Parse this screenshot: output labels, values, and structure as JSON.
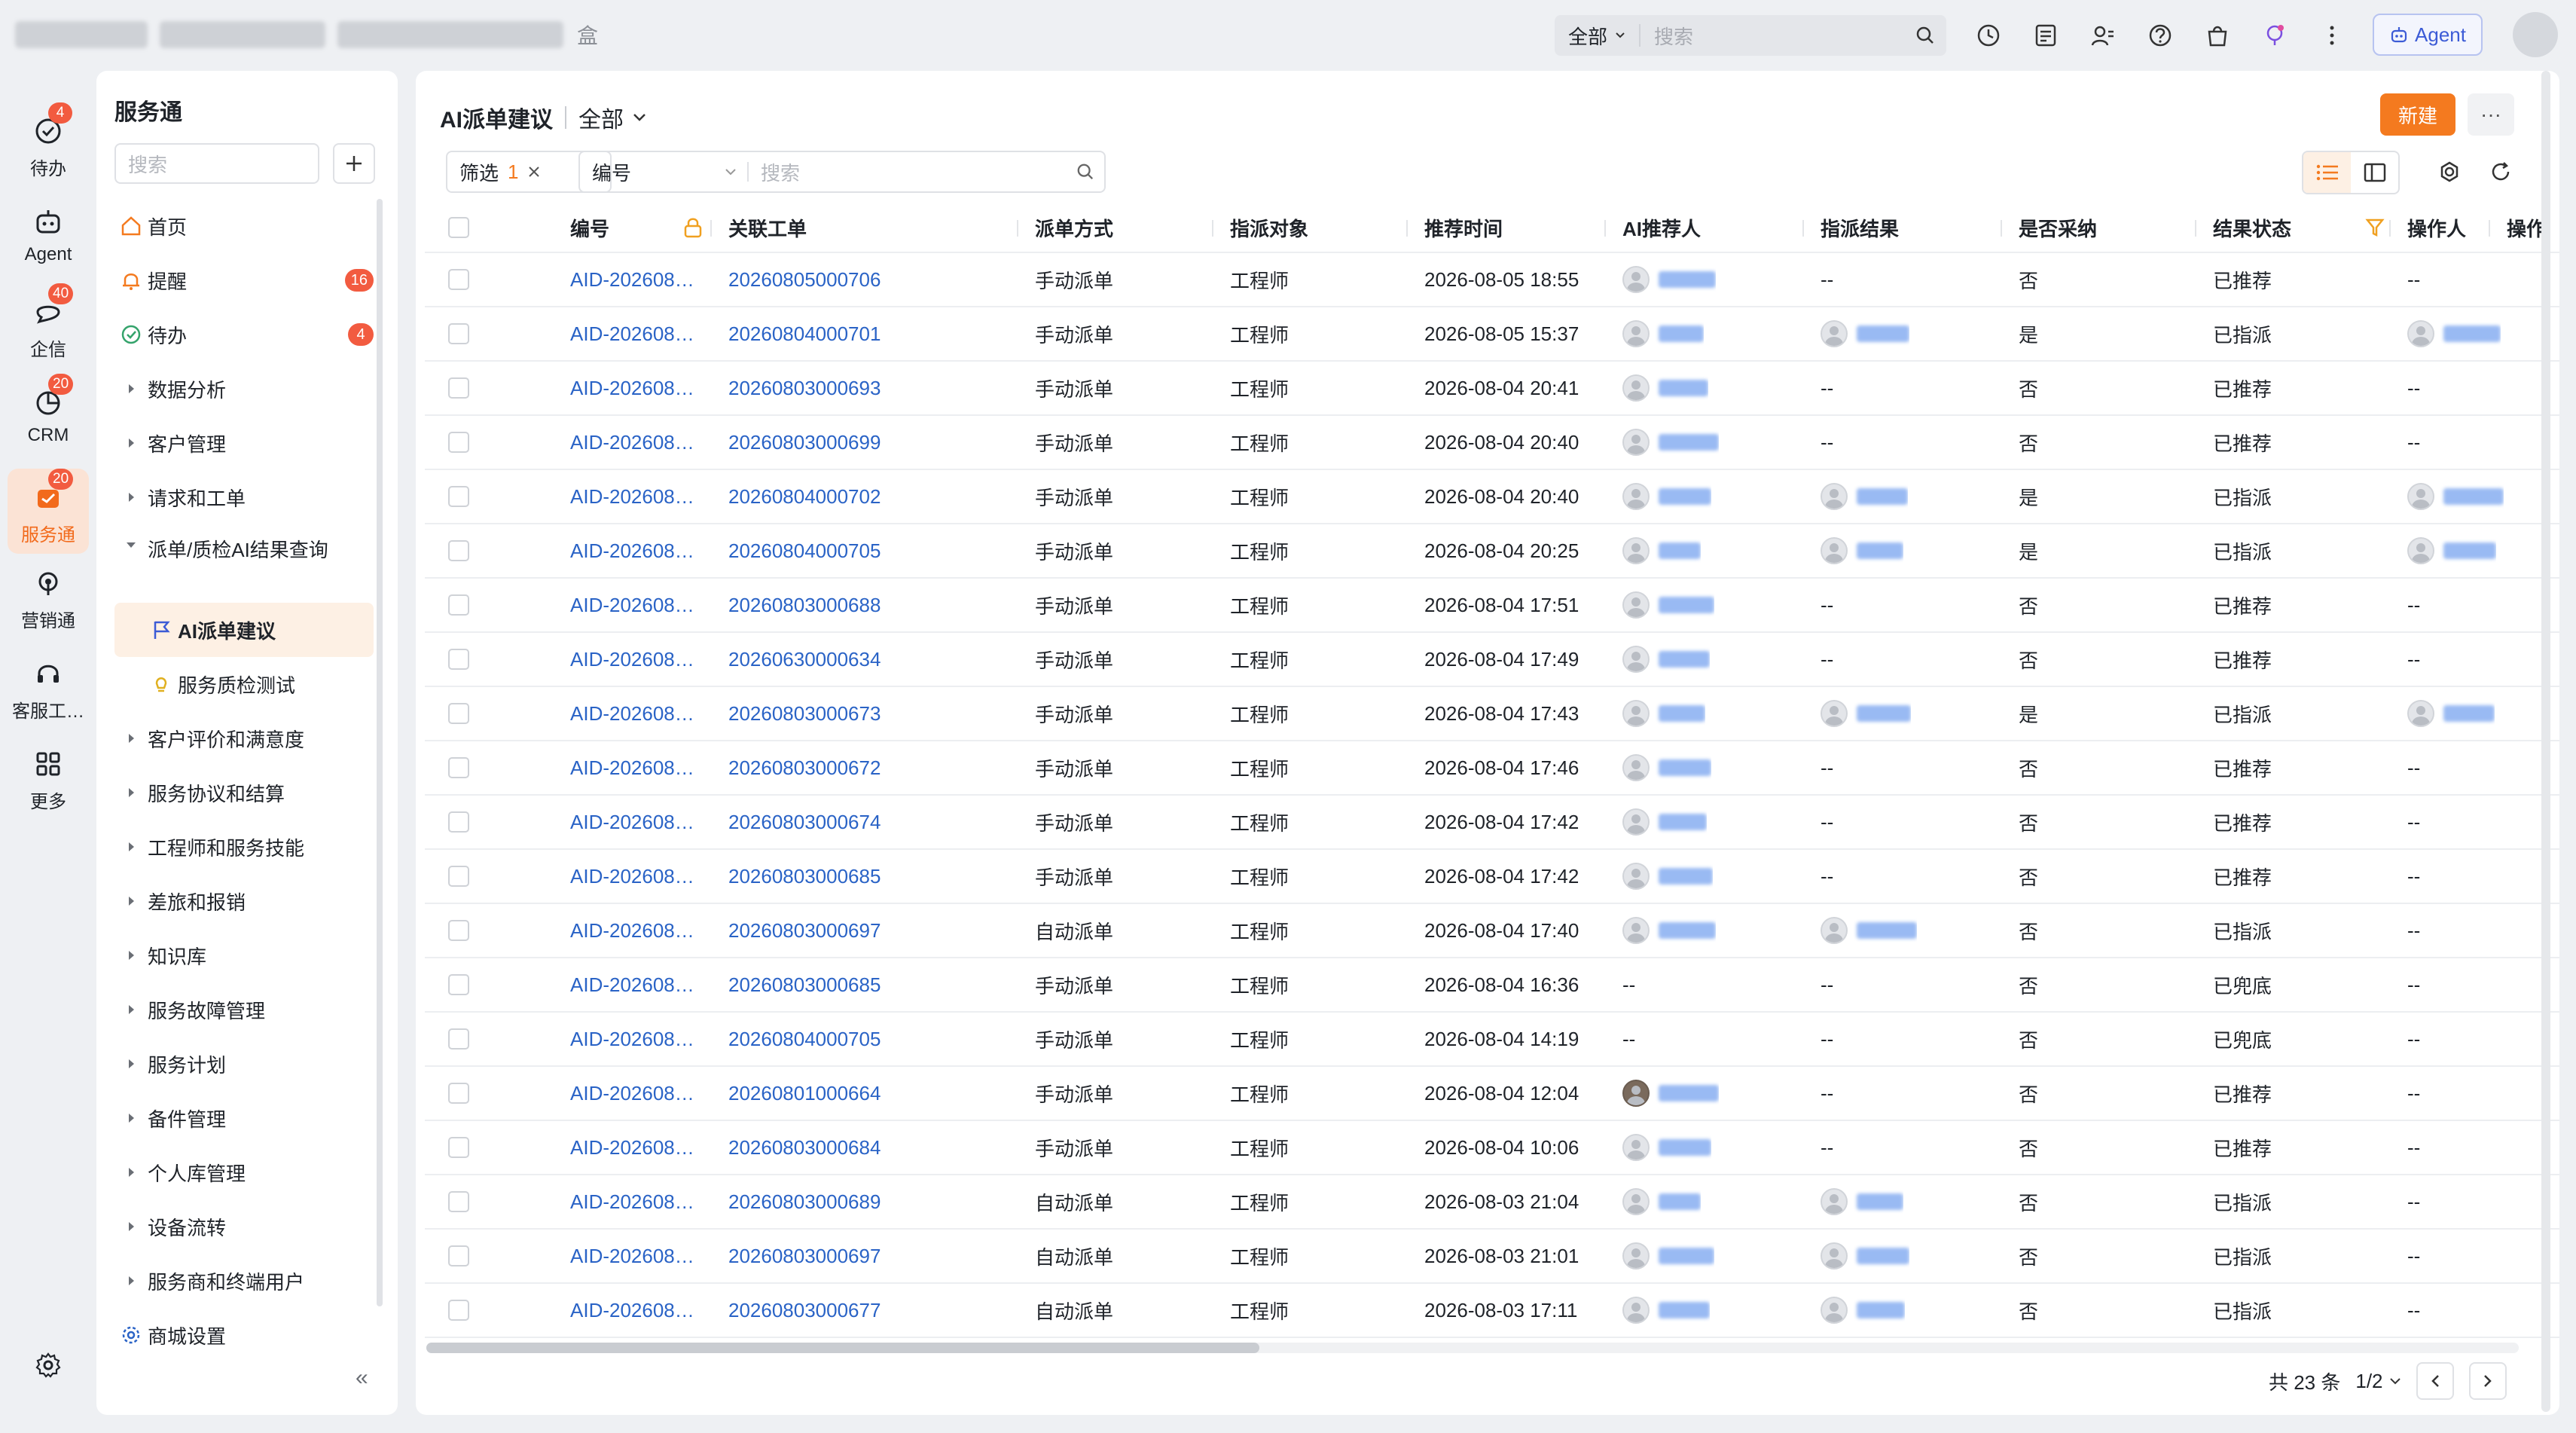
{
  "topbar": {
    "brand_tail": "盒",
    "search_scope": "全部",
    "search_placeholder": "搜索",
    "agent_label": "Agent"
  },
  "rail": [
    {
      "label": "待办",
      "badge": "4",
      "icon": "check-circle-icon"
    },
    {
      "label": "Agent",
      "badge": "",
      "icon": "robot-icon"
    },
    {
      "label": "企信",
      "badge": "40",
      "icon": "chat-icon"
    },
    {
      "label": "CRM",
      "badge": "20",
      "icon": "pie-icon"
    },
    {
      "label": "服务通",
      "badge": "20",
      "icon": "service-icon",
      "active": true
    },
    {
      "label": "营销通",
      "badge": "",
      "icon": "broadcast-icon"
    },
    {
      "label": "客服工…",
      "badge": "",
      "icon": "headset-icon"
    },
    {
      "label": "更多",
      "badge": "",
      "icon": "grid-icon"
    }
  ],
  "sidebar": {
    "title": "服务通",
    "search_placeholder": "搜索",
    "items": [
      {
        "label": "首页",
        "lead": "home-icon"
      },
      {
        "label": "提醒",
        "lead": "bell-icon",
        "badge": "16"
      },
      {
        "label": "待办",
        "lead": "check-icon",
        "badge": "4"
      },
      {
        "label": "数据分析",
        "lead": "caret-right"
      },
      {
        "label": "客户管理",
        "lead": "caret-right"
      },
      {
        "label": "请求和工单",
        "lead": "caret-right"
      },
      {
        "label": "派单/质检AI结果查询",
        "lead": "caret-down"
      },
      {
        "label": "AI派单建议",
        "lead": "flag-icon",
        "sub": true,
        "active": true
      },
      {
        "label": "服务质检测试",
        "lead": "bulb-icon",
        "sub": true
      },
      {
        "label": "客户评价和满意度",
        "lead": "caret-right"
      },
      {
        "label": "服务协议和结算",
        "lead": "caret-right"
      },
      {
        "label": "工程师和服务技能",
        "lead": "caret-right"
      },
      {
        "label": "差旅和报销",
        "lead": "caret-right"
      },
      {
        "label": "知识库",
        "lead": "caret-right"
      },
      {
        "label": "服务故障管理",
        "lead": "caret-right"
      },
      {
        "label": "服务计划",
        "lead": "caret-right"
      },
      {
        "label": "备件管理",
        "lead": "caret-right"
      },
      {
        "label": "个人库管理",
        "lead": "caret-right"
      },
      {
        "label": "设备流转",
        "lead": "caret-right"
      },
      {
        "label": "服务商和终端用户",
        "lead": "caret-right"
      },
      {
        "label": "商城设置",
        "lead": "gear-small-icon"
      }
    ]
  },
  "main": {
    "title": "AI派单建议",
    "scope": "全部",
    "new_label": "新建",
    "more_label": "···",
    "filter_label": "筛选",
    "filter_count": "1",
    "field_label": "编号",
    "field_placeholder": "搜索"
  },
  "table": {
    "columns": [
      "编号",
      "关联工单",
      "派单方式",
      "指派对象",
      "推荐时间",
      "AI推荐人",
      "指派结果",
      "是否采纳",
      "结果状态",
      "操作人",
      "操作"
    ],
    "rows": [
      {
        "id": "AID-202608…",
        "order": "20260805000706",
        "method": "手动派单",
        "target": "工程师",
        "time": "2026-08-05 18:55",
        "rec": "p",
        "result": "--",
        "adopt": "否",
        "status": "已推荐",
        "op": "--"
      },
      {
        "id": "AID-202608…",
        "order": "20260804000701",
        "method": "手动派单",
        "target": "工程师",
        "time": "2026-08-05 15:37",
        "rec": "p",
        "result": "p",
        "adopt": "是",
        "status": "已指派",
        "op": "p"
      },
      {
        "id": "AID-202608…",
        "order": "20260803000693",
        "method": "手动派单",
        "target": "工程师",
        "time": "2026-08-04 20:41",
        "rec": "p",
        "result": "--",
        "adopt": "否",
        "status": "已推荐",
        "op": "--"
      },
      {
        "id": "AID-202608…",
        "order": "20260803000699",
        "method": "手动派单",
        "target": "工程师",
        "time": "2026-08-04 20:40",
        "rec": "p",
        "result": "--",
        "adopt": "否",
        "status": "已推荐",
        "op": "--"
      },
      {
        "id": "AID-202608…",
        "order": "20260804000702",
        "method": "手动派单",
        "target": "工程师",
        "time": "2026-08-04 20:40",
        "rec": "p",
        "result": "p",
        "adopt": "是",
        "status": "已指派",
        "op": "p"
      },
      {
        "id": "AID-202608…",
        "order": "20260804000705",
        "method": "手动派单",
        "target": "工程师",
        "time": "2026-08-04 20:25",
        "rec": "p",
        "result": "p",
        "adopt": "是",
        "status": "已指派",
        "op": "p"
      },
      {
        "id": "AID-202608…",
        "order": "20260803000688",
        "method": "手动派单",
        "target": "工程师",
        "time": "2026-08-04 17:51",
        "rec": "p",
        "result": "--",
        "adopt": "否",
        "status": "已推荐",
        "op": "--"
      },
      {
        "id": "AID-202608…",
        "order": "20260630000634",
        "method": "手动派单",
        "target": "工程师",
        "time": "2026-08-04 17:49",
        "rec": "p",
        "result": "--",
        "adopt": "否",
        "status": "已推荐",
        "op": "--"
      },
      {
        "id": "AID-202608…",
        "order": "20260803000673",
        "method": "手动派单",
        "target": "工程师",
        "time": "2026-08-04 17:43",
        "rec": "p",
        "result": "p",
        "adopt": "是",
        "status": "已指派",
        "op": "p"
      },
      {
        "id": "AID-202608…",
        "order": "20260803000672",
        "method": "手动派单",
        "target": "工程师",
        "time": "2026-08-04 17:46",
        "rec": "p",
        "result": "--",
        "adopt": "否",
        "status": "已推荐",
        "op": "--"
      },
      {
        "id": "AID-202608…",
        "order": "20260803000674",
        "method": "手动派单",
        "target": "工程师",
        "time": "2026-08-04 17:42",
        "rec": "p",
        "result": "--",
        "adopt": "否",
        "status": "已推荐",
        "op": "--"
      },
      {
        "id": "AID-202608…",
        "order": "20260803000685",
        "method": "手动派单",
        "target": "工程师",
        "time": "2026-08-04 17:42",
        "rec": "p",
        "result": "--",
        "adopt": "否",
        "status": "已推荐",
        "op": "--"
      },
      {
        "id": "AID-202608…",
        "order": "20260803000697",
        "method": "自动派单",
        "target": "工程师",
        "time": "2026-08-04 17:40",
        "rec": "p",
        "result": "p",
        "adopt": "否",
        "status": "已指派",
        "op": "--"
      },
      {
        "id": "AID-202608…",
        "order": "20260803000685",
        "method": "手动派单",
        "target": "工程师",
        "time": "2026-08-04 16:36",
        "rec": "--",
        "result": "--",
        "adopt": "否",
        "status": "已兜底",
        "op": "--"
      },
      {
        "id": "AID-202608…",
        "order": "20260804000705",
        "method": "手动派单",
        "target": "工程师",
        "time": "2026-08-04 14:19",
        "rec": "--",
        "result": "--",
        "adopt": "否",
        "status": "已兜底",
        "op": "--"
      },
      {
        "id": "AID-202608…",
        "order": "20260801000664",
        "method": "手动派单",
        "target": "工程师",
        "time": "2026-08-04 12:04",
        "rec": "photo",
        "result": "--",
        "adopt": "否",
        "status": "已推荐",
        "op": "--"
      },
      {
        "id": "AID-202608…",
        "order": "20260803000684",
        "method": "手动派单",
        "target": "工程师",
        "time": "2026-08-04 10:06",
        "rec": "p",
        "result": "--",
        "adopt": "否",
        "status": "已推荐",
        "op": "--"
      },
      {
        "id": "AID-202608…",
        "order": "20260803000689",
        "method": "自动派单",
        "target": "工程师",
        "time": "2026-08-03 21:04",
        "rec": "p",
        "result": "p",
        "adopt": "否",
        "status": "已指派",
        "op": "--"
      },
      {
        "id": "AID-202608…",
        "order": "20260803000697",
        "method": "自动派单",
        "target": "工程师",
        "time": "2026-08-03 21:01",
        "rec": "p",
        "result": "p",
        "adopt": "否",
        "status": "已指派",
        "op": "--"
      },
      {
        "id": "AID-202608…",
        "order": "20260803000677",
        "method": "自动派单",
        "target": "工程师",
        "time": "2026-08-03 17:11",
        "rec": "p",
        "result": "p",
        "adopt": "否",
        "status": "已指派",
        "op": "--"
      }
    ]
  },
  "pager": {
    "total": "共 23 条",
    "page": "1/2"
  },
  "colors": {
    "accent": "#f47a1f",
    "link": "#2a63c6",
    "badge": "#f25b40"
  }
}
